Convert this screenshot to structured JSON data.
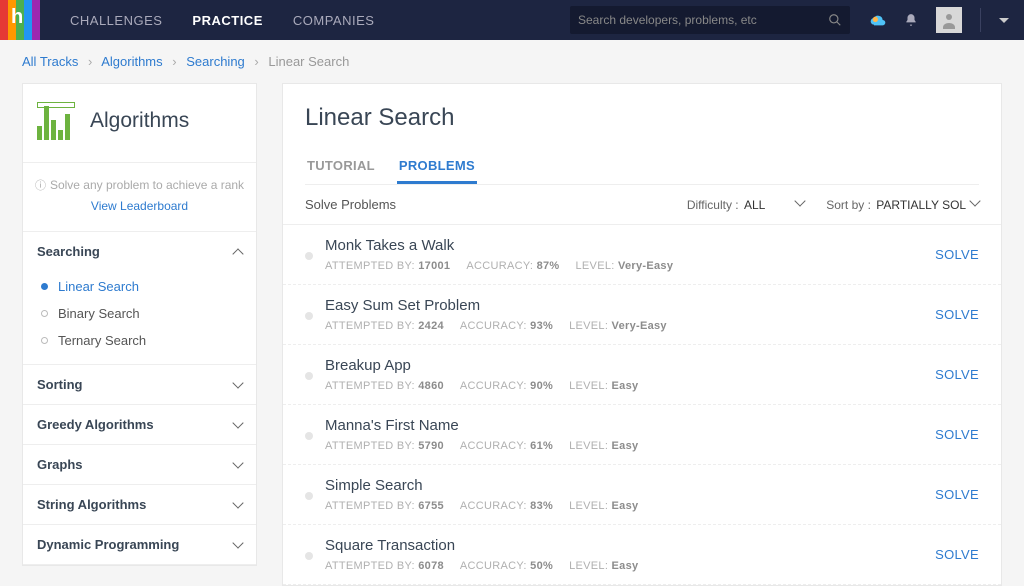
{
  "header": {
    "nav": {
      "challenges": "CHALLENGES",
      "practice": "PRACTICE",
      "companies": "COMPANIES"
    },
    "search_placeholder": "Search developers, problems, etc"
  },
  "breadcrumb": {
    "all_tracks": "All Tracks",
    "algorithms": "Algorithms",
    "searching": "Searching",
    "current": "Linear Search"
  },
  "sidebar": {
    "title": "Algorithms",
    "rank_text": "Solve any problem to achieve a rank",
    "leaderboard_link": "View Leaderboard",
    "sections": {
      "searching": {
        "title": "Searching",
        "items": [
          {
            "label": "Linear Search",
            "active": true
          },
          {
            "label": "Binary Search",
            "active": false
          },
          {
            "label": "Ternary Search",
            "active": false
          }
        ]
      },
      "sorting": {
        "title": "Sorting"
      },
      "greedy": {
        "title": "Greedy Algorithms"
      },
      "graphs": {
        "title": "Graphs"
      },
      "string": {
        "title": "String Algorithms"
      },
      "dynamic": {
        "title": "Dynamic Programming"
      }
    }
  },
  "main": {
    "title": "Linear Search",
    "tabs": {
      "tutorial": "TUTORIAL",
      "problems": "PROBLEMS"
    },
    "solve_heading": "Solve Problems",
    "filter_difficulty_label": "Difficulty :",
    "filter_difficulty_value": "ALL",
    "filter_sort_label": "Sort by :",
    "filter_sort_value": "PARTIALLY SOL",
    "labels": {
      "attempted": "ATTEMPTED BY:",
      "accuracy": "ACCURACY:",
      "level": "LEVEL:",
      "solve": "SOLVE"
    },
    "problems": [
      {
        "name": "Monk Takes a Walk",
        "attempted": "17001",
        "accuracy": "87%",
        "level": "Very-Easy"
      },
      {
        "name": "Easy Sum Set Problem",
        "attempted": "2424",
        "accuracy": "93%",
        "level": "Very-Easy"
      },
      {
        "name": "Breakup App",
        "attempted": "4860",
        "accuracy": "90%",
        "level": "Easy"
      },
      {
        "name": "Manna's First Name",
        "attempted": "5790",
        "accuracy": "61%",
        "level": "Easy"
      },
      {
        "name": "Simple Search",
        "attempted": "6755",
        "accuracy": "83%",
        "level": "Easy"
      },
      {
        "name": "Square Transaction",
        "attempted": "6078",
        "accuracy": "50%",
        "level": "Easy"
      }
    ]
  }
}
